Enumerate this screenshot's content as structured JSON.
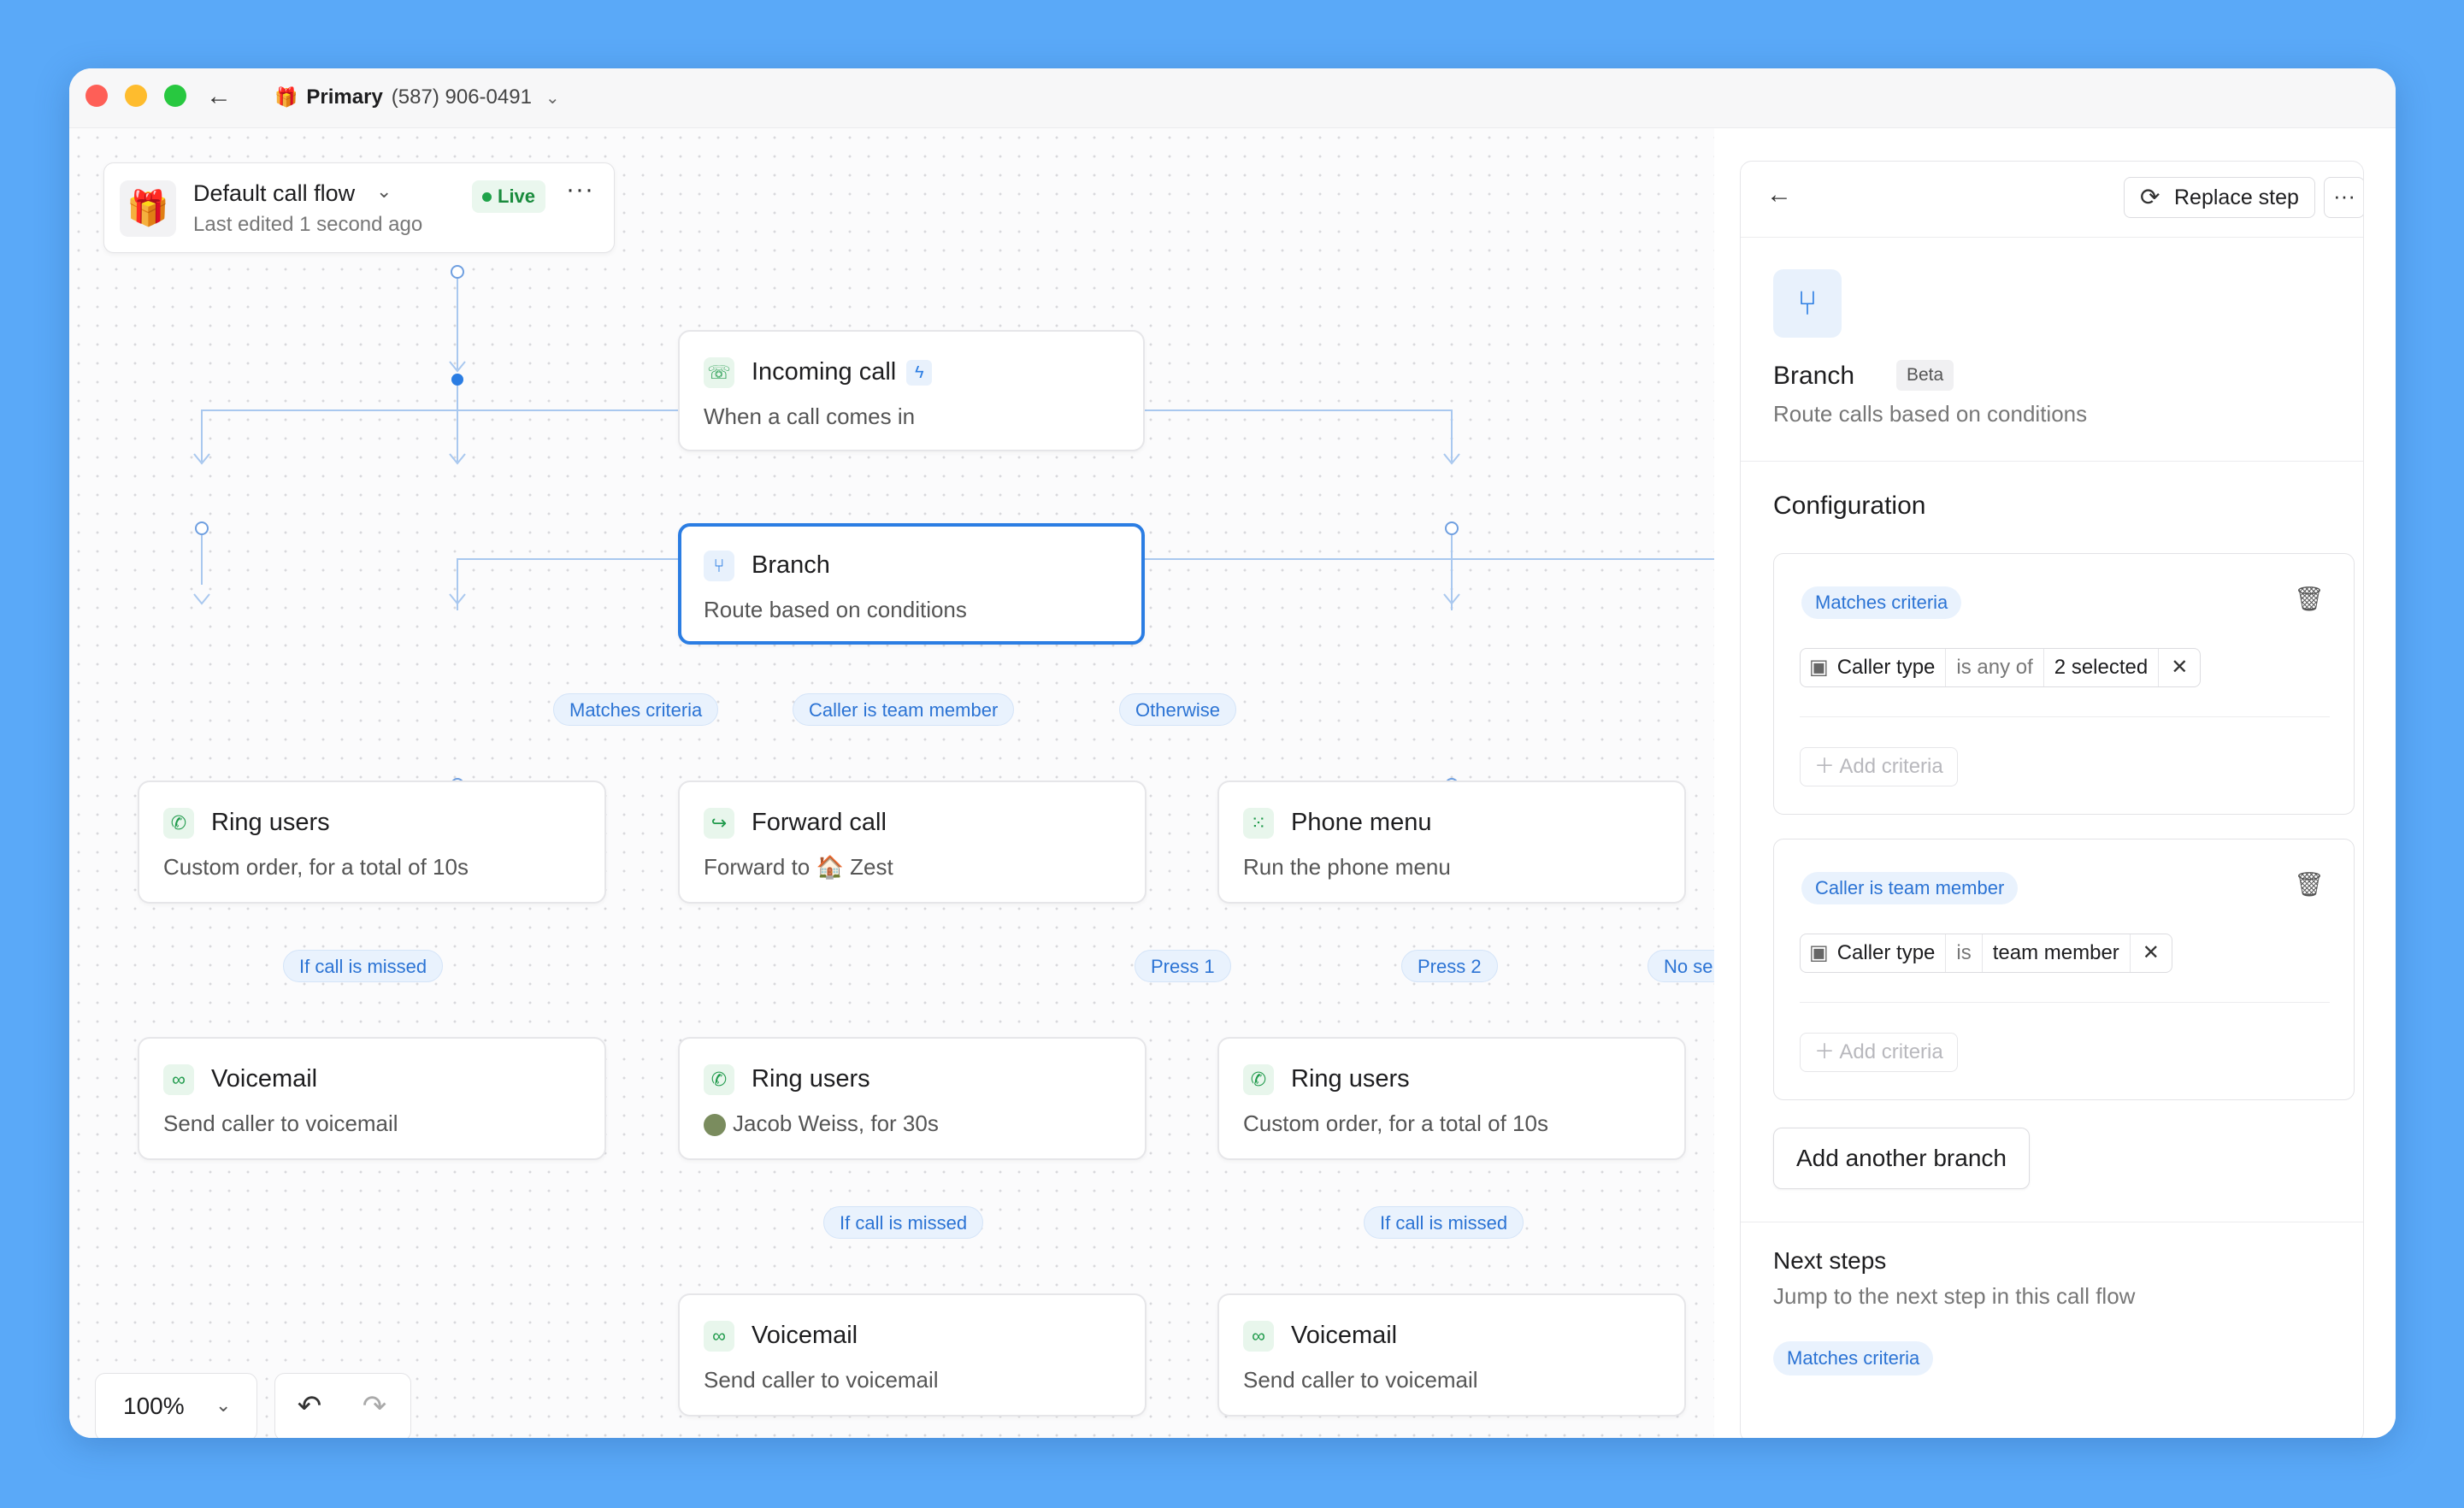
{
  "titlebar": {
    "phone_name": "Primary",
    "phone_number": "(587) 906-0491"
  },
  "flow_header": {
    "title": "Default call flow",
    "subtitle": "Last edited 1 second ago",
    "status": "Live"
  },
  "nodes": {
    "incoming": {
      "title": "Incoming call",
      "subtitle": "When a call comes in"
    },
    "branch": {
      "title": "Branch",
      "subtitle": "Route based on conditions"
    },
    "ring1": {
      "title": "Ring users",
      "subtitle": "Custom order, for a total of 10s"
    },
    "forward": {
      "title": "Forward call",
      "subtitle_prefix": "Forward to",
      "subtitle_target": "Zest"
    },
    "phonemenu": {
      "title": "Phone menu",
      "subtitle": "Run the phone menu"
    },
    "voicemail1": {
      "title": "Voicemail",
      "subtitle": "Send caller to voicemail"
    },
    "ring2": {
      "title": "Ring users",
      "subtitle": "Jacob Weiss, for 30s"
    },
    "ring3": {
      "title": "Ring users",
      "subtitle": "Custom order, for a total of 10s"
    },
    "voicemail2": {
      "title": "Voicemail",
      "subtitle": "Send caller to voicemail"
    },
    "voicemail3": {
      "title": "Voicemail",
      "subtitle": "Send caller to voicemail"
    }
  },
  "edge_labels": {
    "matches": "Matches criteria",
    "team": "Caller is team member",
    "otherwise": "Otherwise",
    "missed1": "If call is missed",
    "press1": "Press 1",
    "press2": "Press 2",
    "noselection": "No se",
    "missed2": "If call is missed",
    "missed3": "If call is missed"
  },
  "zoom": {
    "value": "100%"
  },
  "panel": {
    "replace_label": "Replace step",
    "title": "Branch",
    "badge": "Beta",
    "subtitle": "Route calls based on conditions",
    "configuration_label": "Configuration",
    "branches": [
      {
        "label": "Matches criteria",
        "field": "Caller type",
        "operator": "is any of",
        "value": "2 selected",
        "add_label": "Add criteria"
      },
      {
        "label": "Caller is team member",
        "field": "Caller type",
        "operator": "is",
        "value": "team member",
        "add_label": "Add criteria"
      }
    ],
    "add_branch_label": "Add another branch",
    "next_steps_title": "Next steps",
    "next_steps_subtitle": "Jump to the next step in this call flow",
    "next_steps_pill": "Matches criteria"
  },
  "colors": {
    "accent": "#2b7de3",
    "live": "#1a8b3d",
    "background": "#5aa9f8"
  }
}
